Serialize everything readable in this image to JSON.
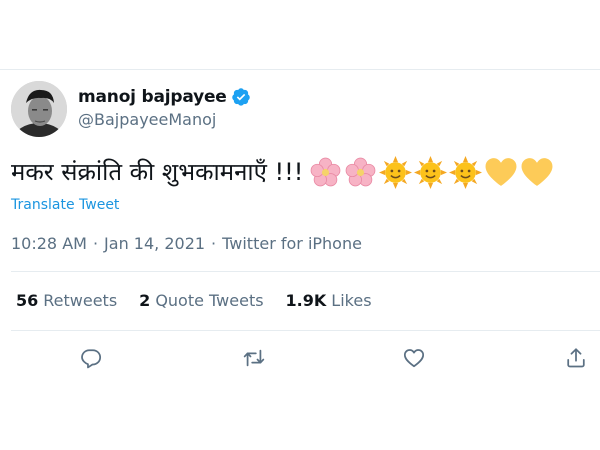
{
  "author": {
    "display_name": "manoj bajpayee",
    "handle": "@BajpayeeManoj",
    "verified": true
  },
  "tweet": {
    "text": "मकर संक्रांति की शुभकामनाएँ !!!",
    "emojis": [
      "cherry-blossom",
      "cherry-blossom",
      "sun-with-face",
      "sun-with-face",
      "sun-with-face",
      "yellow-heart",
      "yellow-heart"
    ],
    "translate_label": "Translate Tweet"
  },
  "meta": {
    "time": "10:28 AM",
    "separator": "·",
    "date": "Jan 14, 2021",
    "source": "Twitter for iPhone"
  },
  "stats": {
    "retweets_count": "56",
    "retweets_label": "Retweets",
    "quote_count": "2",
    "quote_label": "Quote Tweets",
    "likes_count": "1.9K",
    "likes_label": "Likes"
  },
  "actions": [
    "reply-icon",
    "retweet-icon",
    "like-icon",
    "share-icon"
  ],
  "colors": {
    "link": "#1b95e0",
    "muted": "#5b7083",
    "verified": "#1da1f2",
    "divider": "#e6ecf0"
  }
}
